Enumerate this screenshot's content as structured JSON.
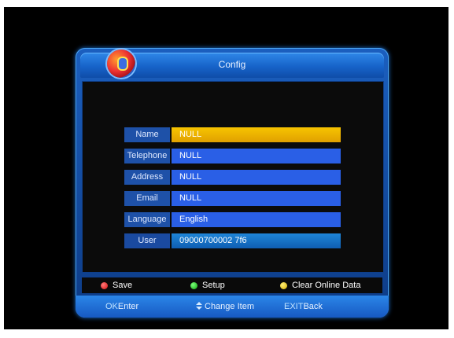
{
  "title": "Config",
  "fields": [
    {
      "label": "Name",
      "value": "NULL"
    },
    {
      "label": "Telephone",
      "value": "NULL"
    },
    {
      "label": "Address",
      "value": "NULL"
    },
    {
      "label": "Email",
      "value": "NULL"
    },
    {
      "label": "Language",
      "value": "English"
    },
    {
      "label": "User",
      "value": "09000700002 7f6"
    }
  ],
  "color_keys": {
    "red": "Save",
    "green": "Setup",
    "yellow": "Clear Online Data"
  },
  "footer": {
    "ok_key": "OK",
    "ok_label": "Enter",
    "change_label": "Change Item",
    "exit_key": "EXIT",
    "exit_label": "Back"
  },
  "colors": {
    "accent": "#2a5fe6",
    "selected": "#f0b800",
    "panel": "#1b5fbf"
  },
  "icons": {
    "logo": "parrot-logo-icon",
    "change": "up-down-arrow-icon"
  }
}
